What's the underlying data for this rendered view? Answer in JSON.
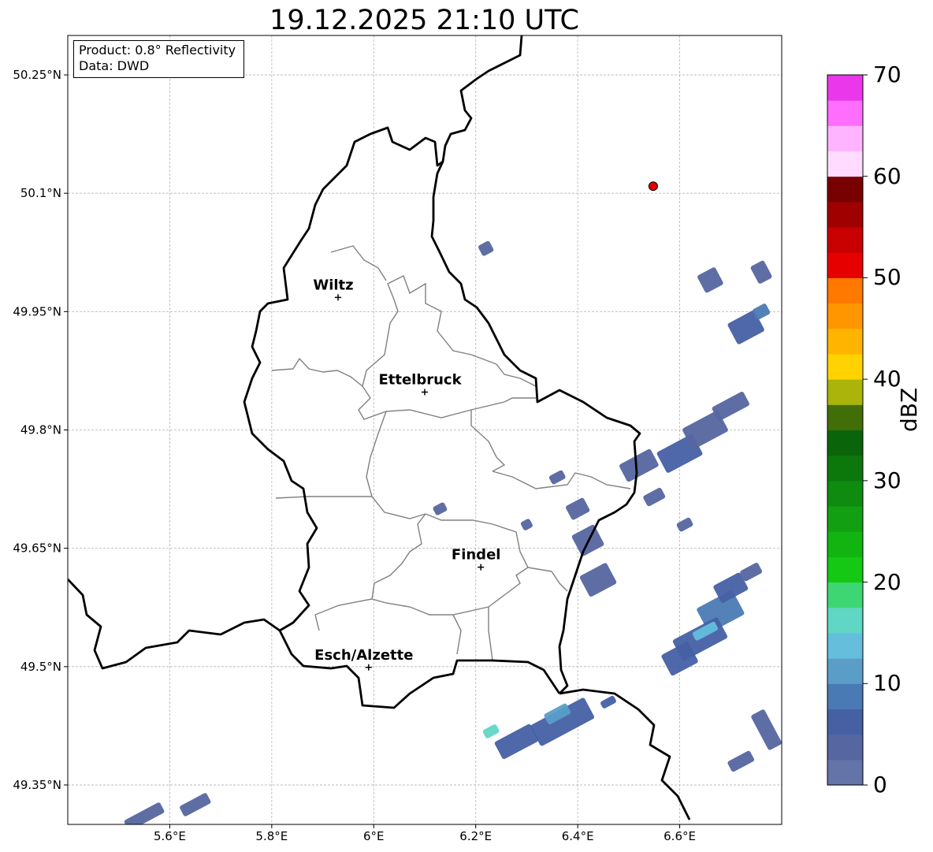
{
  "title": "19.12.2025 21:10 UTC",
  "info": {
    "product": "Product: 0.8° Reflectivity",
    "source": "Data: DWD"
  },
  "map": {
    "lon_range": [
      5.4,
      6.8
    ],
    "lat_range": [
      49.3,
      50.3
    ],
    "lon_ticks": [
      {
        "value": 5.6,
        "label": "5.6°E"
      },
      {
        "value": 5.8,
        "label": "5.8°E"
      },
      {
        "value": 6.0,
        "label": "6°E"
      },
      {
        "value": 6.2,
        "label": "6.2°E"
      },
      {
        "value": 6.4,
        "label": "6.4°E"
      },
      {
        "value": 6.6,
        "label": "6.6°E"
      }
    ],
    "lat_ticks": [
      {
        "value": 49.35,
        "label": "49.35°N"
      },
      {
        "value": 49.5,
        "label": "49.5°N"
      },
      {
        "value": 49.65,
        "label": "49.65°N"
      },
      {
        "value": 49.8,
        "label": "49.8°N"
      },
      {
        "value": 49.95,
        "label": "49.95°N"
      },
      {
        "value": 50.1,
        "label": "50.1°N"
      },
      {
        "value": 50.25,
        "label": "50.25°N"
      }
    ],
    "cities": [
      {
        "name": "Wiltz",
        "lon": 5.93,
        "lat": 49.968
      },
      {
        "name": "Ettelbruck",
        "lon": 6.1,
        "lat": 49.848
      },
      {
        "name": "Findel",
        "lon": 6.21,
        "lat": 49.626
      },
      {
        "name": "Esch/Alzette",
        "lon": 5.99,
        "lat": 49.499
      }
    ],
    "radar_site": {
      "lon": 6.548,
      "lat": 50.109,
      "color": "#e00000"
    }
  },
  "colorbar": {
    "label": "dBZ",
    "min": 0,
    "max": 70,
    "ticks": [
      "0",
      "10",
      "20",
      "30",
      "40",
      "50",
      "60",
      "70"
    ],
    "colors": [
      "#6473a8",
      "#5566a0",
      "#4660a4",
      "#4a7ab4",
      "#5a9ec8",
      "#64bedc",
      "#60d6c4",
      "#3ed674",
      "#14c814",
      "#12b412",
      "#12a012",
      "#0f8c0f",
      "#0c780c",
      "#0a640a",
      "#426e0a",
      "#aab40a",
      "#ffd200",
      "#ffb400",
      "#ff9600",
      "#ff7800",
      "#e60000",
      "#c80000",
      "#a00000",
      "#780000",
      "#ffdcff",
      "#ffb4ff",
      "#ff6eff",
      "#eb37eb"
    ]
  },
  "precip_cells": [
    {
      "lon": 6.37,
      "lat": 49.43,
      "w": 0.12,
      "h": 0.03,
      "dbz": 5
    },
    {
      "lon": 6.28,
      "lat": 49.405,
      "w": 0.08,
      "h": 0.025,
      "dbz": 6
    },
    {
      "lon": 6.23,
      "lat": 49.418,
      "w": 0.03,
      "h": 0.012,
      "dbz": 15
    },
    {
      "lon": 6.36,
      "lat": 49.44,
      "w": 0.05,
      "h": 0.015,
      "dbz": 12
    },
    {
      "lon": 6.46,
      "lat": 49.455,
      "w": 0.03,
      "h": 0.01,
      "dbz": 5
    },
    {
      "lon": 6.68,
      "lat": 49.57,
      "w": 0.08,
      "h": 0.035,
      "dbz": 8
    },
    {
      "lon": 6.64,
      "lat": 49.535,
      "w": 0.1,
      "h": 0.03,
      "dbz": 6
    },
    {
      "lon": 6.6,
      "lat": 49.51,
      "w": 0.06,
      "h": 0.03,
      "dbz": 5
    },
    {
      "lon": 6.65,
      "lat": 49.545,
      "w": 0.05,
      "h": 0.012,
      "dbz": 13
    },
    {
      "lon": 6.7,
      "lat": 49.6,
      "w": 0.06,
      "h": 0.025,
      "dbz": 5
    },
    {
      "lon": 6.74,
      "lat": 49.62,
      "w": 0.04,
      "h": 0.015,
      "dbz": 4
    },
    {
      "lon": 6.77,
      "lat": 49.42,
      "w": 0.03,
      "h": 0.05,
      "dbz": 4
    },
    {
      "lon": 6.72,
      "lat": 49.38,
      "w": 0.05,
      "h": 0.015,
      "dbz": 3
    },
    {
      "lon": 6.44,
      "lat": 49.61,
      "w": 0.06,
      "h": 0.03,
      "dbz": 4
    },
    {
      "lon": 6.42,
      "lat": 49.66,
      "w": 0.05,
      "h": 0.03,
      "dbz": 4
    },
    {
      "lon": 6.4,
      "lat": 49.7,
      "w": 0.04,
      "h": 0.02,
      "dbz": 3
    },
    {
      "lon": 6.36,
      "lat": 49.74,
      "w": 0.03,
      "h": 0.012,
      "dbz": 3
    },
    {
      "lon": 6.3,
      "lat": 49.68,
      "w": 0.02,
      "h": 0.012,
      "dbz": 3
    },
    {
      "lon": 6.6,
      "lat": 49.77,
      "w": 0.08,
      "h": 0.03,
      "dbz": 5
    },
    {
      "lon": 6.52,
      "lat": 49.755,
      "w": 0.07,
      "h": 0.025,
      "dbz": 4
    },
    {
      "lon": 6.65,
      "lat": 49.8,
      "w": 0.08,
      "h": 0.03,
      "dbz": 4
    },
    {
      "lon": 6.7,
      "lat": 49.83,
      "w": 0.07,
      "h": 0.02,
      "dbz": 3
    },
    {
      "lon": 6.55,
      "lat": 49.715,
      "w": 0.04,
      "h": 0.015,
      "dbz": 3
    },
    {
      "lon": 6.61,
      "lat": 49.68,
      "w": 0.03,
      "h": 0.012,
      "dbz": 3
    },
    {
      "lon": 6.73,
      "lat": 49.93,
      "w": 0.06,
      "h": 0.03,
      "dbz": 5
    },
    {
      "lon": 6.76,
      "lat": 49.95,
      "w": 0.03,
      "h": 0.015,
      "dbz": 9
    },
    {
      "lon": 6.66,
      "lat": 49.99,
      "w": 0.04,
      "h": 0.025,
      "dbz": 3
    },
    {
      "lon": 6.76,
      "lat": 50.0,
      "w": 0.03,
      "h": 0.025,
      "dbz": 3
    },
    {
      "lon": 6.22,
      "lat": 50.03,
      "w": 0.025,
      "h": 0.015,
      "dbz": 3
    },
    {
      "lon": 6.13,
      "lat": 49.7,
      "w": 0.025,
      "h": 0.012,
      "dbz": 3
    },
    {
      "lon": 5.55,
      "lat": 49.31,
      "w": 0.08,
      "h": 0.015,
      "dbz": 3
    },
    {
      "lon": 5.65,
      "lat": 49.325,
      "w": 0.06,
      "h": 0.015,
      "dbz": 3
    }
  ]
}
